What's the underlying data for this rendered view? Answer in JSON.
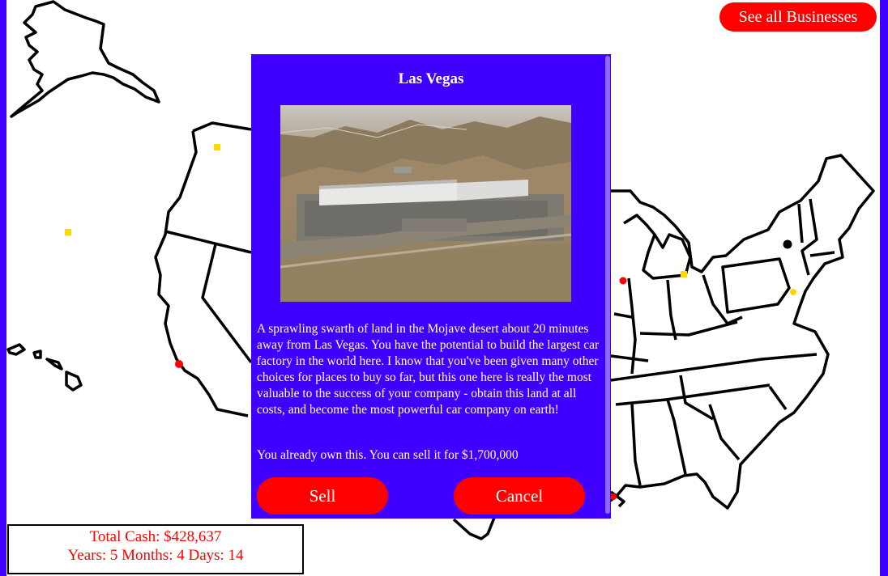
{
  "header": {
    "see_all_label": "See all Businesses"
  },
  "stats": {
    "total_cash": "Total Cash: $428,637",
    "time": "Years: 5 Months: 4 Days: 14"
  },
  "modal": {
    "title": "Las Vegas",
    "photo_alt": "Las Vegas",
    "description": "A sprawling swarth of land in the Mojave desert about 20 minutes away from Las Vegas. You have the potential to build the largest car factory in the world here. I know that you've been given many other choices for places to buy so far, but this one here is really the most valuable to the success of your company - obtain this land at all costs, and become the most powerful car company on earth!",
    "ownership": "You already own this. You can sell it for $1,700,000",
    "sell_label": "Sell",
    "cancel_label": "Cancel"
  },
  "colors": {
    "frame": "#4000ff",
    "modal_bg": "#4000ff",
    "button": "#ff0000",
    "stats_text": "#ff0000",
    "marker_owned": "#ff0000",
    "marker_available": "#ffd700",
    "marker_other": "#000000"
  },
  "icons": [
    "map-of-united-states",
    "location-marker"
  ]
}
